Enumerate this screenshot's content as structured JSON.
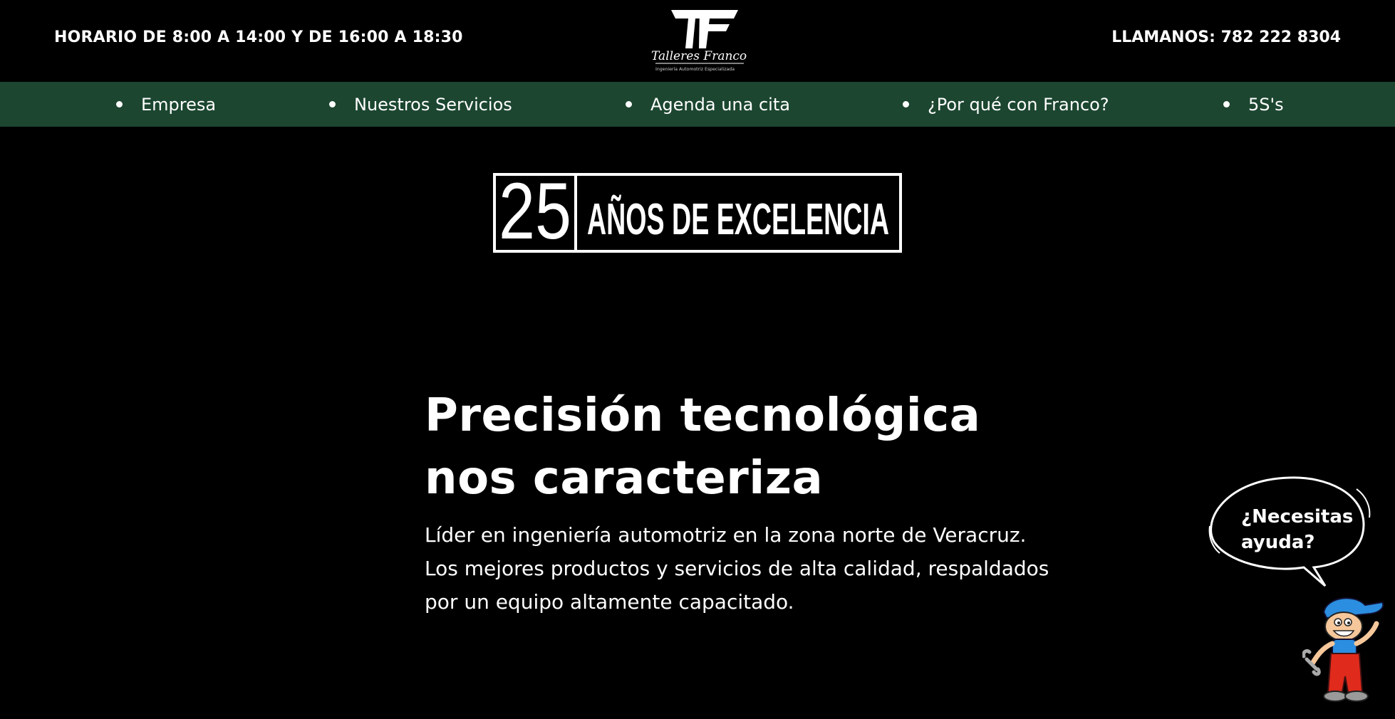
{
  "header": {
    "hours": "HORARIO DE 8:00 A 14:00 Y DE 16:00 A 18:30",
    "phone": "LLAMANOS: 782 222 8304",
    "logo": {
      "brand_script": "Talleres Franco",
      "tagline": "Ingeniería Automotriz Especializada"
    }
  },
  "nav": {
    "items": [
      {
        "label": "Empresa"
      },
      {
        "label": "Nuestros Servicios"
      },
      {
        "label": "Agenda una cita"
      },
      {
        "label": "¿Por qué con Franco?"
      },
      {
        "label": "5S's"
      }
    ]
  },
  "badge": {
    "number": "25",
    "text": "AÑOS DE EXCELENCIA"
  },
  "hero": {
    "headline_line1": "Precisión tecnológica",
    "headline_line2": "nos caracteriza",
    "lead_line1": "Líder en ingeniería automotriz en la zona norte de Veracruz.",
    "lead_line2": "Los mejores productos y servicios de alta calidad, respaldados",
    "lead_line3": "por un equipo altamente capacitado."
  },
  "help_widget": {
    "line1": "¿Necesitas",
    "line2": "ayuda?",
    "mascot": "mechanic-mascot-icon"
  },
  "colors": {
    "background": "#000000",
    "nav_background": "#1c4630",
    "text": "#ffffff",
    "mascot_blue": "#2b8ee0",
    "mascot_red": "#e02a1c"
  }
}
